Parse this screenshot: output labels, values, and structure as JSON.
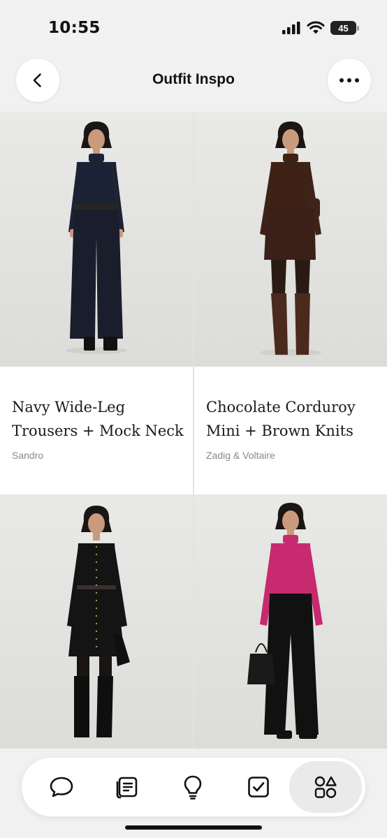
{
  "status_bar": {
    "time": "10:55",
    "battery_level": "45",
    "icons": [
      "cellular-signal-icon",
      "wifi-icon",
      "battery-icon"
    ]
  },
  "header": {
    "title": "Outfit Inspo",
    "back_icon": "chevron-left-icon",
    "more_icon": "ellipsis-icon"
  },
  "outfits": [
    {
      "name": "Navy Wide-Leg Trousers + Mock Neck",
      "brand": "Sandro",
      "colors": {
        "top": "#1c2236",
        "bottom": "#1a1e2c",
        "shoes": "#111111",
        "bag": "#2a2522",
        "tights": "#2a1d18"
      }
    },
    {
      "name": "Chocolate Corduroy Mini + Brown Knits",
      "brand": "Zadig & Voltaire",
      "colors": {
        "top": "#3f2216",
        "bottom": "#3a2018",
        "shoes": "#4a2a1c",
        "bag": "#3e2419",
        "tights": "#2a1a14"
      }
    },
    {
      "name": "",
      "brand": "",
      "colors": {
        "top": "#141414",
        "bottom": "#141414",
        "shoes": "#0f0f0f",
        "bag": "#0f0f0f",
        "tights": "#1a1414"
      }
    },
    {
      "name": "",
      "brand": "",
      "colors": {
        "top": "#c72a6e",
        "bottom": "#111111",
        "shoes": "#111111",
        "bag": "#1a1a1a",
        "tights": "#111111"
      }
    }
  ],
  "tab_bar": {
    "tabs": [
      {
        "name": "chat-bubble-icon",
        "active": false
      },
      {
        "name": "notes-icon",
        "active": false
      },
      {
        "name": "lightbulb-icon",
        "active": false
      },
      {
        "name": "checkbox-icon",
        "active": false
      },
      {
        "name": "shapes-icon",
        "active": true
      }
    ]
  }
}
